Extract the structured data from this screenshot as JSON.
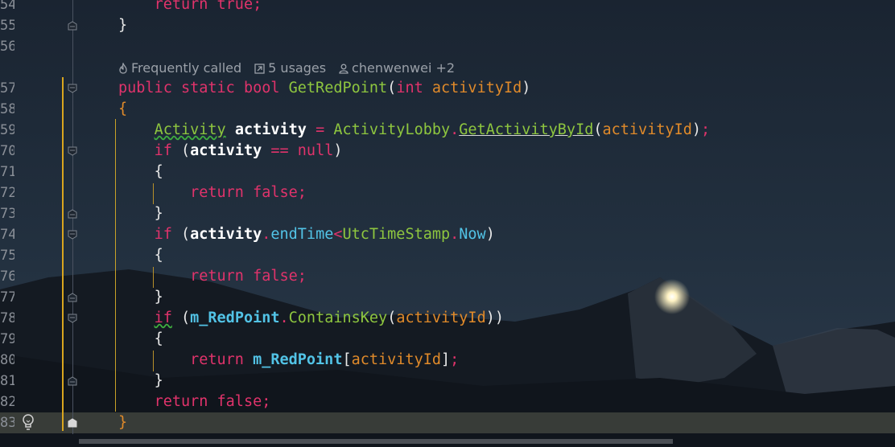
{
  "editor": {
    "line_numbers": [
      "54",
      "55",
      "56",
      "57",
      "58",
      "59",
      "70",
      "71",
      "72",
      "73",
      "74",
      "75",
      "76",
      "77",
      "78",
      "79",
      "80",
      "81",
      "82",
      "83"
    ],
    "code_lens": {
      "frequently_called": "Frequently called",
      "usages": "5 usages",
      "author": "chenwenwei +2"
    },
    "code": {
      "l54_return": "return",
      "l54_true": "true;",
      "l55_brace": "}",
      "l57_public": "public",
      "l57_static": "static",
      "l57_bool": "bool",
      "l57_name": "GetRedPoint",
      "l57_int": "int",
      "l57_param": "activityId",
      "l58_brace": "{",
      "l59_type": "Activity",
      "l59_var": "activity",
      "l59_class": "ActivityLobby",
      "l59_method": "GetActivityById",
      "l59_arg": "activityId",
      "if": "if",
      "l70_var": "activity",
      "null": "null",
      "return": "return",
      "false": "false",
      "l74_var": "activity",
      "l74_prop": "endTime",
      "l74_class": "UtcTimeStamp",
      "l74_now": "Now",
      "l78_field": "m_RedPoint",
      "l78_method": "ContainsKey",
      "l78_arg": "activityId",
      "l80_field": "m_RedPoint",
      "l80_arg": "activityId",
      "l83_brace": "}"
    }
  },
  "colors": {
    "keyword": "#e0336b",
    "type": "#8ec63f",
    "parameter": "#e08a2a",
    "property": "#52c3e6",
    "background": "#1b2430"
  }
}
